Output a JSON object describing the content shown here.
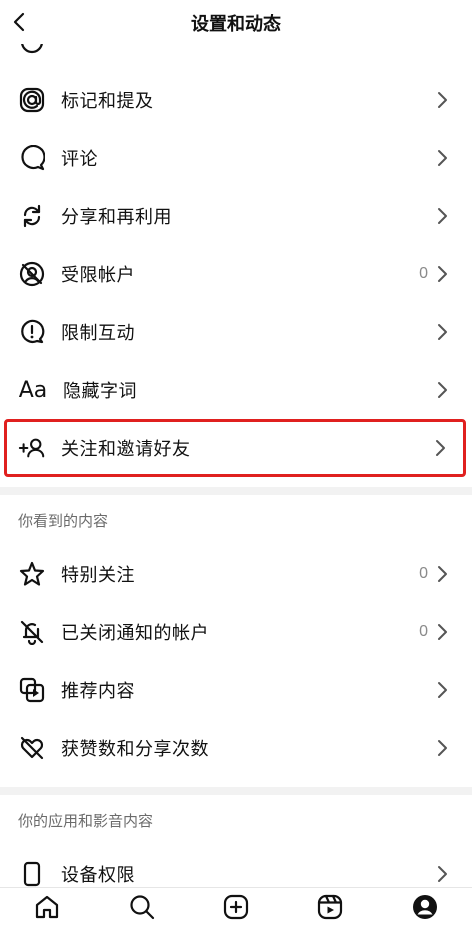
{
  "header": {
    "title": "设置和动态"
  },
  "rows_top": [
    {
      "label": "标记和提及",
      "icon": "at-sign-icon"
    },
    {
      "label": "评论",
      "icon": "comment-icon"
    },
    {
      "label": "分享和再利用",
      "icon": "reshare-icon"
    },
    {
      "label": "受限帐户",
      "icon": "restricted-icon",
      "count": "0"
    },
    {
      "label": "限制互动",
      "icon": "limit-interactions-icon"
    },
    {
      "label": "隐藏字词",
      "icon": "hidden-words-icon",
      "glyph": "Aa"
    }
  ],
  "highlight_row": {
    "label": "关注和邀请好友",
    "icon": "follow-invite-icon",
    "glyph": "+"
  },
  "section_content": {
    "title": "你看到的内容",
    "rows": [
      {
        "label": "特别关注",
        "icon": "star-icon",
        "count": "0"
      },
      {
        "label": "已关闭通知的帐户",
        "icon": "bell-off-icon",
        "count": "0"
      },
      {
        "label": "推荐内容",
        "icon": "suggested-content-icon"
      },
      {
        "label": "获赞数和分享次数",
        "icon": "heart-off-icon"
      }
    ]
  },
  "section_app": {
    "title": "你的应用和影音内容",
    "rows": [
      {
        "label": "设备权限",
        "icon": "device-icon"
      }
    ]
  },
  "tabbar": [
    "home-icon",
    "search-icon",
    "create-icon",
    "reels-icon",
    "profile-icon"
  ],
  "colors": {
    "highlight": "#e0201f",
    "text": "#111111",
    "muted": "#8a8a8a"
  }
}
